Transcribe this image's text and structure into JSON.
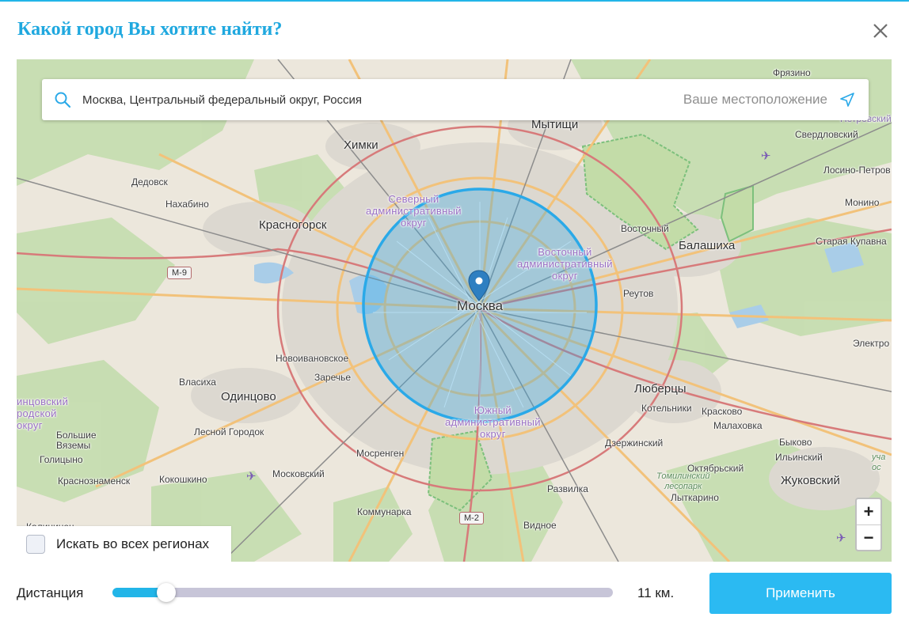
{
  "dialog": {
    "title": "Какой город Вы хотите найти?",
    "close_icon": "close-icon"
  },
  "search": {
    "value": "Москва, Центральный федеральный округ, Россия",
    "my_location_label": "Ваше местоположение",
    "search_icon": "search-icon",
    "location_icon": "navigation-arrow-icon"
  },
  "map": {
    "center_label": "Москва",
    "marker_icon": "map-pin-icon",
    "radius_color": "#2aa9e8",
    "labels": {
      "frjazino": "Фрязино",
      "mytishchi": "Мытищи",
      "khimki": "Химки",
      "sverdlovskij": "Свердловский",
      "losino": "Лосино-Петров",
      "dedovsk": "Дедовск",
      "nakhabino": "Нахабино",
      "monino": "Монино",
      "krasnogorsk": "Красногорск",
      "vostochnyj": "Восточный",
      "balashikha": "Балашиха",
      "staraja_kupavna": "Старая Купавна",
      "reutov": "Реутов",
      "elektrougli": "Электро",
      "novoivanovskoe": "Новоивановское",
      "zarechie": "Заречье",
      "vlasikha": "Власиха",
      "odintsovo": "Одинцово",
      "lyubertsy": "Люберцы",
      "kotelniki": "Котельники",
      "kraskovo": "Красково",
      "malakhovka": "Малаховка",
      "bolshie_vyazemy": "Большие\nВяземы",
      "golitsyno": "Голицыно",
      "lesnoj_gorodok": "Лесной Городок",
      "mosrentgen": "Мосренген",
      "dzerzhinskij": "Дзержинский",
      "bykovo": "Быково",
      "ilinskij": "Ильинский",
      "oktyabrskij": "Октябрьский",
      "krasnoznamensk": "Краснознаменск",
      "kokoshkino": "Кокошкино",
      "moskovskij": "Московский",
      "zhukovskij": "Жуковский",
      "razvilka": "Развилка",
      "lytkarino": "Лыткарино",
      "kommunarka": "Коммунарка",
      "vidnoe": "Видное",
      "karinskoe": "Калининец",
      "sever_district": "Северный\nадминистративный\nокруг",
      "vostok_district": "Восточный\nадминистративный\nокруг",
      "south_district": "Южный\nадминистративный\nокруг",
      "west_district": "инцовский\nродской\nокруг",
      "tominskij": "Томилинский\nлесопарк",
      "uchas": "уча\nос",
      "petrovskij": "Петровский"
    },
    "road_m9": "М-9",
    "road_m2": "М-2",
    "zoom_in_label": "+",
    "zoom_out_label": "−"
  },
  "all_regions": {
    "label": "Искать во всех регионах",
    "checked": false
  },
  "distance": {
    "label": "Дистанция",
    "value_text": "11 км.",
    "fraction": 0.108
  },
  "apply_button": {
    "label": "Применить"
  }
}
